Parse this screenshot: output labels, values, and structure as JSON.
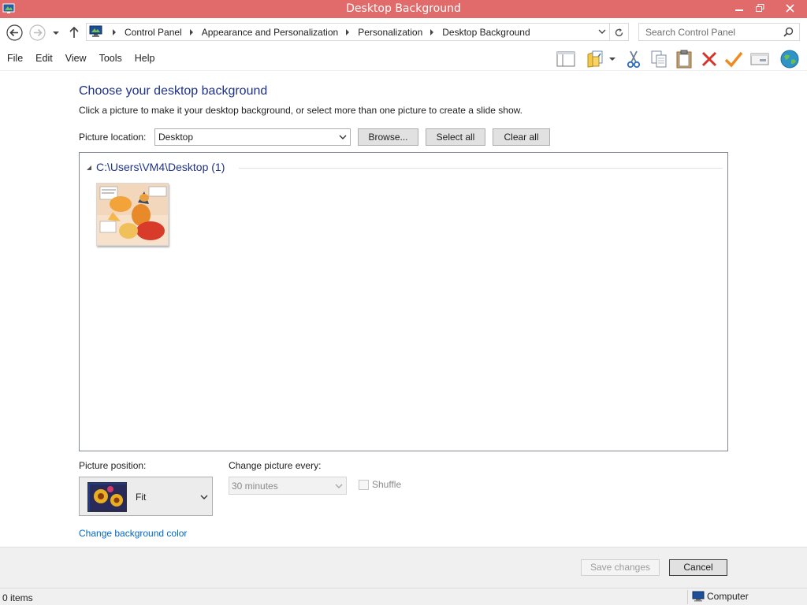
{
  "window": {
    "title": "Desktop Background",
    "minimize_glyph": "—",
    "maximize_glyph": "❐",
    "close_glyph": "✕"
  },
  "address": {
    "breadcrumbs": [
      "Control Panel",
      "Appearance and Personalization",
      "Personalization",
      "Desktop Background"
    ],
    "search_placeholder": "Search Control Panel"
  },
  "menu": {
    "items": [
      "File",
      "Edit",
      "View",
      "Tools",
      "Help"
    ]
  },
  "toolbar": {
    "icons": [
      "layout-icon",
      "folder-options-icon",
      "cut-icon",
      "copy-icon",
      "paste-icon",
      "delete-icon",
      "check-icon",
      "properties-icon",
      "globe-icon"
    ]
  },
  "main": {
    "heading": "Choose your desktop background",
    "description": "Click a picture to make it your desktop background, or select more than one picture to create a slide show.",
    "picture_location_label": "Picture location:",
    "picture_location_value": "Desktop",
    "browse_label": "Browse...",
    "select_all_label": "Select all",
    "clear_all_label": "Clear all",
    "group_title": "C:\\Users\\VM4\\Desktop (1)",
    "picture_position_label": "Picture position:",
    "picture_position_value": "Fit",
    "change_every_label": "Change picture every:",
    "change_every_value": "30 minutes",
    "shuffle_label": "Shuffle",
    "change_color_link": "Change background color"
  },
  "footer": {
    "save_label": "Save changes",
    "cancel_label": "Cancel"
  },
  "status": {
    "items": "0 items",
    "location": "Computer"
  },
  "colors": {
    "titlebar": "#e16a6a",
    "heading": "#1e3287",
    "link": "#0066cc"
  }
}
